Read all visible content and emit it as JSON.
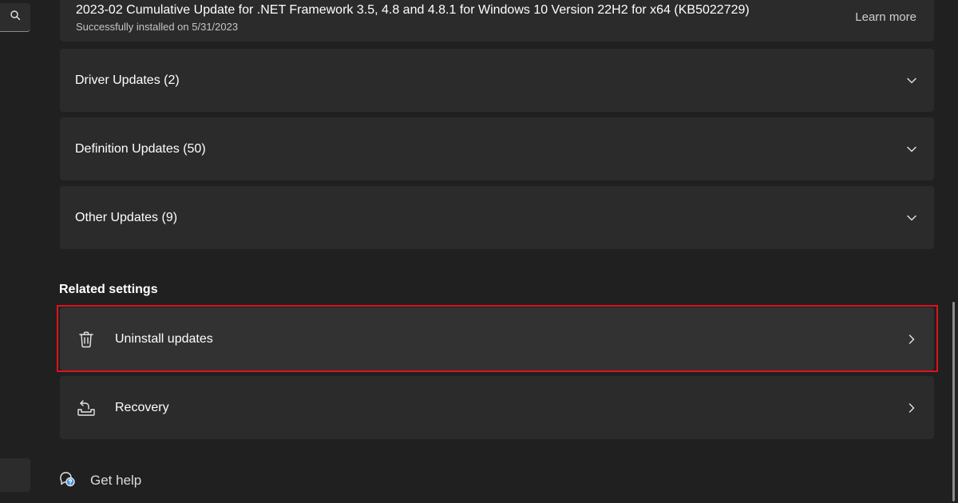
{
  "sidebar": {
    "search_icon": "search-icon"
  },
  "update_item": {
    "title": "2023-02 Cumulative Update for .NET Framework 3.5, 4.8 and 4.8.1 for Windows 10 Version 22H2 for x64 (KB5022729)",
    "status": "Successfully installed on 5/31/2023",
    "learn_more": "Learn more"
  },
  "expanders": [
    {
      "label": "Driver Updates (2)",
      "icon": "chevron-down-icon"
    },
    {
      "label": "Definition Updates (50)",
      "icon": "chevron-down-icon"
    },
    {
      "label": "Other Updates (9)",
      "icon": "chevron-down-icon"
    }
  ],
  "related": {
    "title": "Related settings",
    "items": [
      {
        "label": "Uninstall updates",
        "icon": "trash-icon",
        "highlighted": true
      },
      {
        "label": "Recovery",
        "icon": "recovery-icon",
        "highlighted": false
      }
    ]
  },
  "help": {
    "label": "Get help",
    "icon": "help-chat-icon"
  },
  "colors": {
    "background": "#202020",
    "card": "#2b2b2b",
    "highlight_border": "#e0121c"
  }
}
